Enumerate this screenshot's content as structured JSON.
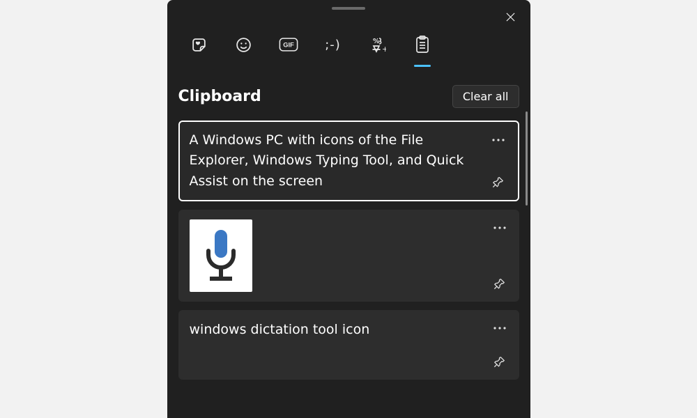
{
  "panel": {
    "close_aria": "Close"
  },
  "tabs": {
    "items": [
      "recent",
      "emoji",
      "gif",
      "kaomoji",
      "symbols",
      "clipboard"
    ],
    "active_index": 5,
    "kaomoji_glyph": ";-)"
  },
  "header": {
    "title": "Clipboard",
    "clear_all": "Clear all"
  },
  "items": [
    {
      "type": "text",
      "selected": true,
      "text": "A Windows PC with icons of the File Explorer, Windows Typing Tool, and Quick Assist on the screen"
    },
    {
      "type": "image",
      "selected": false,
      "image_desc": "microphone-icon"
    },
    {
      "type": "text",
      "selected": false,
      "text": "windows dictation tool icon"
    }
  ],
  "colors": {
    "accent": "#4cc2ff",
    "panel_bg": "#202020",
    "card_bg": "#2d2d2d"
  }
}
